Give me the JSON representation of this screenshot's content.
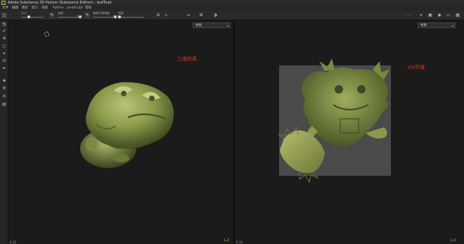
{
  "window": {
    "title": "Adobe Substance 3D Painter (Substance Edition) - leafToad"
  },
  "menu": [
    "文件",
    "编辑",
    "模式",
    "窗口",
    "视图",
    "Python",
    "JavaScript",
    "帮助"
  ],
  "toolbar": {
    "size_label": "大小",
    "flow_label": "流量",
    "flow_value": "100",
    "stroke_opacity_label": "笔刷不透明度",
    "stroke_opacity_value": "100",
    "spacing_label": "间距",
    "size_fraction": 0.35,
    "flow_fraction": 1.0,
    "opacity_fraction": 1.0
  },
  "tools": [
    "paint-brush-icon",
    "eraser-icon",
    "projection-icon",
    "geometry-mask-icon",
    "smudge-icon",
    "clone-icon",
    "picker-icon",
    "polygon-fill-icon",
    "settings-icon",
    "bake-icon",
    "export-icon"
  ],
  "viewport_3d": {
    "mode_dropdown": "材质",
    "annotation": "三维效果",
    "axis_label": "Z",
    "bottom_label": "0 12"
  },
  "viewport_2d": {
    "mode_dropdown": "材质",
    "annotation": "UV平铺",
    "axis_label": "U",
    "bottom_label": "0 12"
  },
  "colors": {
    "annotation": "#e0301e",
    "toad_green": "#8a9a4a",
    "uv_background": "#4a4a4a",
    "gizmo_green": "#9ad13a"
  }
}
